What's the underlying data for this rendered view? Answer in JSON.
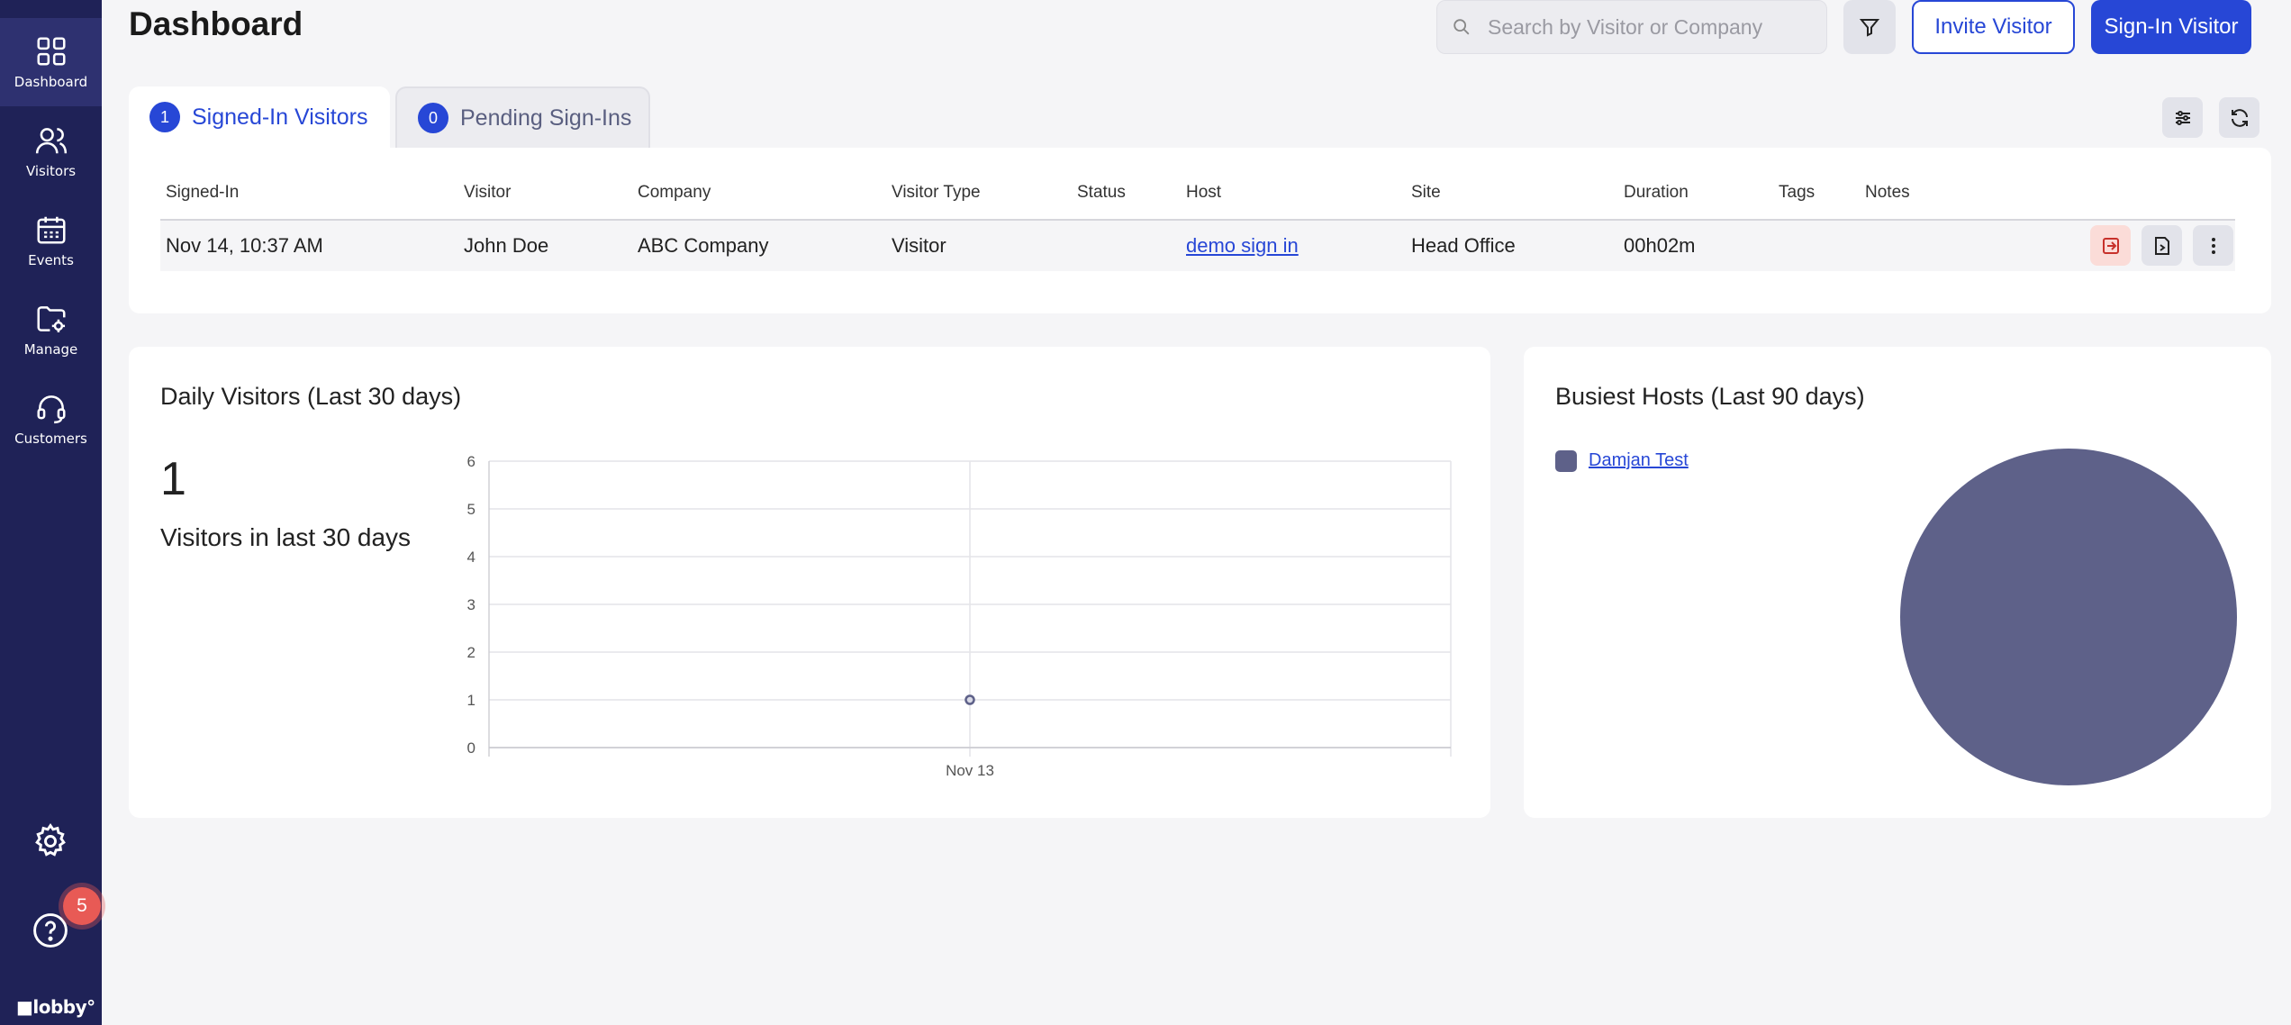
{
  "sidebar": {
    "items": [
      {
        "label": "Dashboard",
        "icon": "grid-icon"
      },
      {
        "label": "Visitors",
        "icon": "users-icon"
      },
      {
        "label": "Events",
        "icon": "calendar-icon"
      },
      {
        "label": "Manage",
        "icon": "folder-gear-icon"
      },
      {
        "label": "Customers",
        "icon": "headset-icon"
      }
    ],
    "notification_count": "5",
    "brand": "■lobby°"
  },
  "header": {
    "title": "Dashboard",
    "search_placeholder": "Search by Visitor or Company",
    "invite_label": "Invite Visitor",
    "signin_label": "Sign-In Visitor"
  },
  "tabs": [
    {
      "count": "1",
      "label": "Signed-In Visitors"
    },
    {
      "count": "0",
      "label": "Pending Sign-Ins"
    }
  ],
  "table": {
    "columns": [
      "Signed-In",
      "Visitor",
      "Company",
      "Visitor Type",
      "Status",
      "Host",
      "Site",
      "Duration",
      "Tags",
      "Notes"
    ],
    "rows": [
      {
        "signed_in": "Nov 14, 10:37 AM",
        "visitor": "John Doe",
        "company": "ABC Company",
        "visitor_type": "Visitor",
        "status": "",
        "host": "demo sign in",
        "site": "Head Office",
        "duration": "00h02m",
        "tags": "",
        "notes": ""
      }
    ]
  },
  "daily": {
    "title": "Daily Visitors (Last 30 days)",
    "count": "1",
    "count_label": "Visitors in last 30 days"
  },
  "hosts": {
    "title": "Busiest Hosts (Last 90 days)"
  },
  "chart_data": [
    {
      "type": "line",
      "title": "Daily Visitors (Last 30 days)",
      "categories": [
        "Nov 13"
      ],
      "series": [
        {
          "values": [
            1
          ]
        }
      ],
      "ylim": [
        0,
        6
      ],
      "yticks": [
        0,
        1,
        2,
        3,
        4,
        5,
        6
      ],
      "grid": true,
      "color": "#5e6189"
    },
    {
      "type": "pie",
      "title": "Busiest Hosts (Last 90 days)",
      "categories": [
        "Damjan Test"
      ],
      "values": [
        1
      ],
      "colors": [
        "#5e6189"
      ],
      "legend": "top-left"
    }
  ]
}
